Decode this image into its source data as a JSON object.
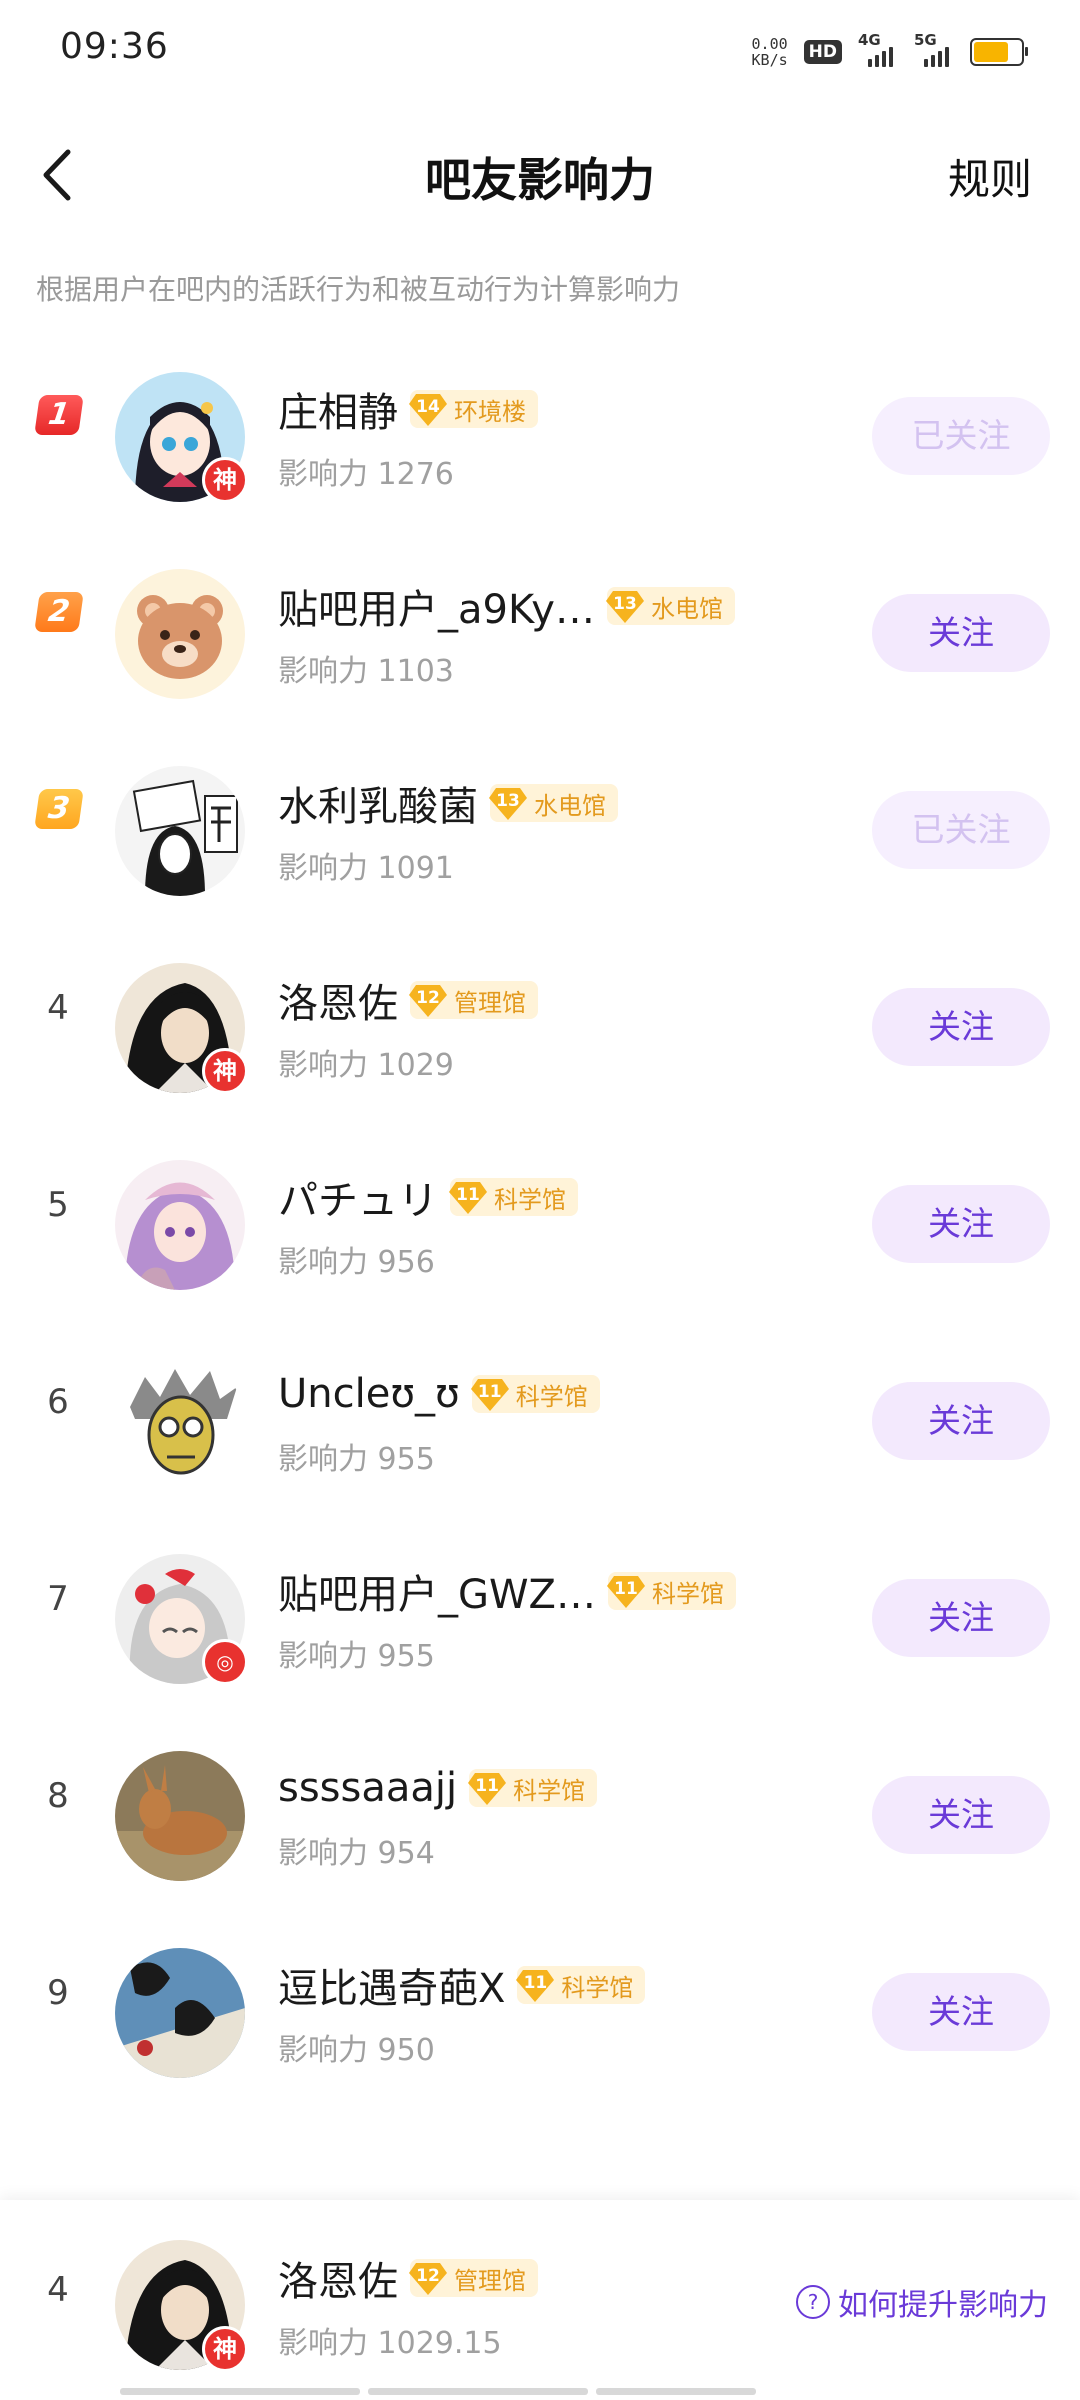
{
  "status_bar": {
    "time": "09:36",
    "net_speed_value": "0.00",
    "net_speed_unit": "KB/s",
    "hd_label": "HD",
    "sim1_label": "4G",
    "sim2_label": "5G",
    "battery_level": 0.75,
    "battery_color": "#f8b400"
  },
  "header": {
    "title": "吧友影响力",
    "rules_label": "规则",
    "back_icon": "chevron-left-icon"
  },
  "subtitle": "根据用户在吧内的活跃行为和被互动行为计算影响力",
  "colors": {
    "accent": "#6a3ad8",
    "button_bg": "#f3e9fd",
    "level_tag_bg": "#fff3d8",
    "level_text": "#e39a1e",
    "god_badge": "#e8322f"
  },
  "influence_prefix": "影响力",
  "users": [
    {
      "rank": "1",
      "name": "庄相静",
      "level": "14",
      "level_name": "环境楼",
      "influence": "影响力 1276",
      "follow_label": "已关注",
      "followed": true,
      "god_badge": "神"
    },
    {
      "rank": "2",
      "name": "贴吧用户_a9Ky…",
      "level": "13",
      "level_name": "水电馆",
      "influence": "影响力 1103",
      "follow_label": "关注",
      "followed": false,
      "god_badge": ""
    },
    {
      "rank": "3",
      "name": "水利乳酸菌",
      "level": "13",
      "level_name": "水电馆",
      "influence": "影响力 1091",
      "follow_label": "已关注",
      "followed": true,
      "god_badge": ""
    },
    {
      "rank": "4",
      "name": "洛恩佐",
      "level": "12",
      "level_name": "管理馆",
      "influence": "影响力 1029",
      "follow_label": "关注",
      "followed": false,
      "god_badge": "神"
    },
    {
      "rank": "5",
      "name": "パチュリ",
      "level": "11",
      "level_name": "科学馆",
      "influence": "影响力 956",
      "follow_label": "关注",
      "followed": false,
      "god_badge": ""
    },
    {
      "rank": "6",
      "name": "Uncleʊ_ʊ",
      "level": "11",
      "level_name": "科学馆",
      "influence": "影响力 955",
      "follow_label": "关注",
      "followed": false,
      "god_badge": ""
    },
    {
      "rank": "7",
      "name": "贴吧用户_GWZ…",
      "level": "11",
      "level_name": "科学馆",
      "influence": "影响力 955",
      "follow_label": "关注",
      "followed": false,
      "god_badge": ""
    },
    {
      "rank": "8",
      "name": "ssssaaajj",
      "level": "11",
      "level_name": "科学馆",
      "influence": "影响力 954",
      "follow_label": "关注",
      "followed": false,
      "god_badge": ""
    },
    {
      "rank": "9",
      "name": "逗比遇奇葩X",
      "level": "11",
      "level_name": "科学馆",
      "influence": "影响力 950",
      "follow_label": "关注",
      "followed": false,
      "god_badge": ""
    }
  ],
  "my_rank": {
    "rank": "4",
    "name": "洛恩佐",
    "level": "12",
    "level_name": "管理馆",
    "influence": "影响力 1029.15",
    "god_badge": "神",
    "how_label": "如何提升影响力",
    "help_icon": "question-circle-icon"
  }
}
